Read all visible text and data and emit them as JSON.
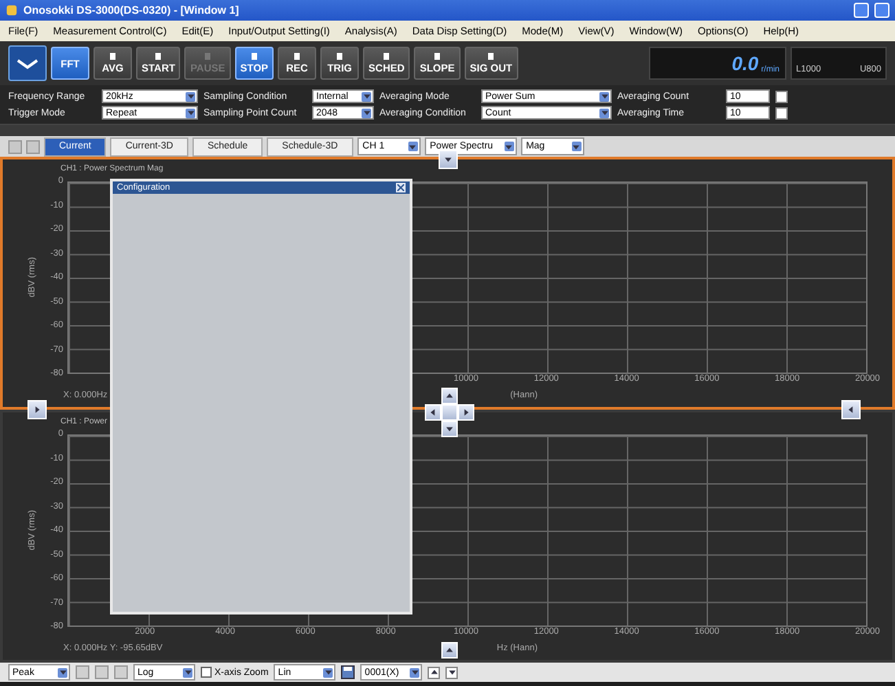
{
  "window": {
    "title": "Onosokki DS-3000(DS-0320) - [Window 1]"
  },
  "menu": [
    "File(F)",
    "Measurement Control(C)",
    "Edit(E)",
    "Input/Output Setting(I)",
    "Analysis(A)",
    "Data Disp Setting(D)",
    "Mode(M)",
    "View(V)",
    "Window(W)",
    "Options(O)",
    "Help(H)"
  ],
  "toolbar": {
    "mode_button": {
      "label": "FFT",
      "selected": true
    },
    "buttons": [
      {
        "label": "AVG",
        "selected": false,
        "disabled": false
      },
      {
        "label": "START",
        "selected": false,
        "disabled": false
      },
      {
        "label": "PAUSE",
        "selected": false,
        "disabled": true
      },
      {
        "label": "STOP",
        "selected": true,
        "disabled": false
      },
      {
        "label": "REC",
        "selected": false,
        "disabled": false
      },
      {
        "label": "TRIG",
        "selected": false,
        "disabled": false
      },
      {
        "label": "SCHED",
        "selected": false,
        "disabled": false
      },
      {
        "label": "SLOPE",
        "selected": false,
        "disabled": false
      },
      {
        "label": "SIG OUT",
        "selected": false,
        "disabled": false
      }
    ],
    "readout": {
      "value": "0.0",
      "unit": "r/min"
    },
    "range": {
      "lower": "L1000",
      "upper": "U800"
    }
  },
  "settings": [
    [
      {
        "label": "Frequency Range",
        "value": "20kHz",
        "kind": "select"
      },
      {
        "label": "Sampling Condition",
        "value": "Internal",
        "kind": "select"
      },
      {
        "label": "Averaging Mode",
        "value": "Power Sum",
        "kind": "select"
      },
      {
        "label": "Averaging Count",
        "value": "10",
        "kind": "input",
        "checked": false
      }
    ],
    [
      {
        "label": "Trigger Mode",
        "value": "Repeat",
        "kind": "select"
      },
      {
        "label": "Sampling Point Count",
        "value": "2048",
        "kind": "select"
      },
      {
        "label": "Averaging Condition",
        "value": "Count",
        "kind": "select"
      },
      {
        "label": "Averaging Time",
        "value": "10",
        "kind": "input",
        "checked": false
      }
    ]
  ],
  "tabs": [
    {
      "label": "Current",
      "selected": true
    },
    {
      "label": "Current-3D",
      "selected": false
    },
    {
      "label": "Schedule",
      "selected": false
    },
    {
      "label": "Schedule-3D",
      "selected": false
    }
  ],
  "selectors": [
    "CH 1",
    "Power Spectru",
    "Mag"
  ],
  "graphs": [
    {
      "title": "CH1 : Power Spectrum Mag",
      "active": true,
      "ylabel": "dBV (rms)",
      "yticks": [
        "0",
        "-10",
        "-20",
        "-30",
        "-40",
        "-50",
        "-60",
        "-70",
        "-80"
      ],
      "xticks": [
        "10000",
        "12000",
        "14000",
        "16000",
        "18000",
        "20000"
      ],
      "cursor": "X: 0.000Hz",
      "xlabel": "(Hann)"
    },
    {
      "title": "CH1 : Power",
      "active": false,
      "ylabel": "dBV (rms)",
      "yticks": [
        "0",
        "-10",
        "-20",
        "-30",
        "-40",
        "-50",
        "-60",
        "-70",
        "-80"
      ],
      "xticks": [
        "2000",
        "4000",
        "6000",
        "8000",
        "10000",
        "12000",
        "14000",
        "16000",
        "18000",
        "20000"
      ],
      "cursor": "X: 0.000Hz Y: -95.65dBV",
      "xlabel": "Hz (Hann)"
    }
  ],
  "dialog": {
    "title": "Configuration"
  },
  "bottom_bar": [
    {
      "kind": "select",
      "value": "Peak"
    },
    {
      "kind": "tool"
    },
    {
      "kind": "tool"
    },
    {
      "kind": "tool"
    },
    {
      "kind": "select",
      "value": "Log"
    },
    {
      "kind": "checkbox",
      "label": "X-axis Zoom",
      "checked": false
    },
    {
      "kind": "select",
      "value": "Lin"
    },
    {
      "kind": "save"
    },
    {
      "kind": "select",
      "value": "0001(X)"
    },
    {
      "kind": "up"
    },
    {
      "kind": "down"
    }
  ]
}
